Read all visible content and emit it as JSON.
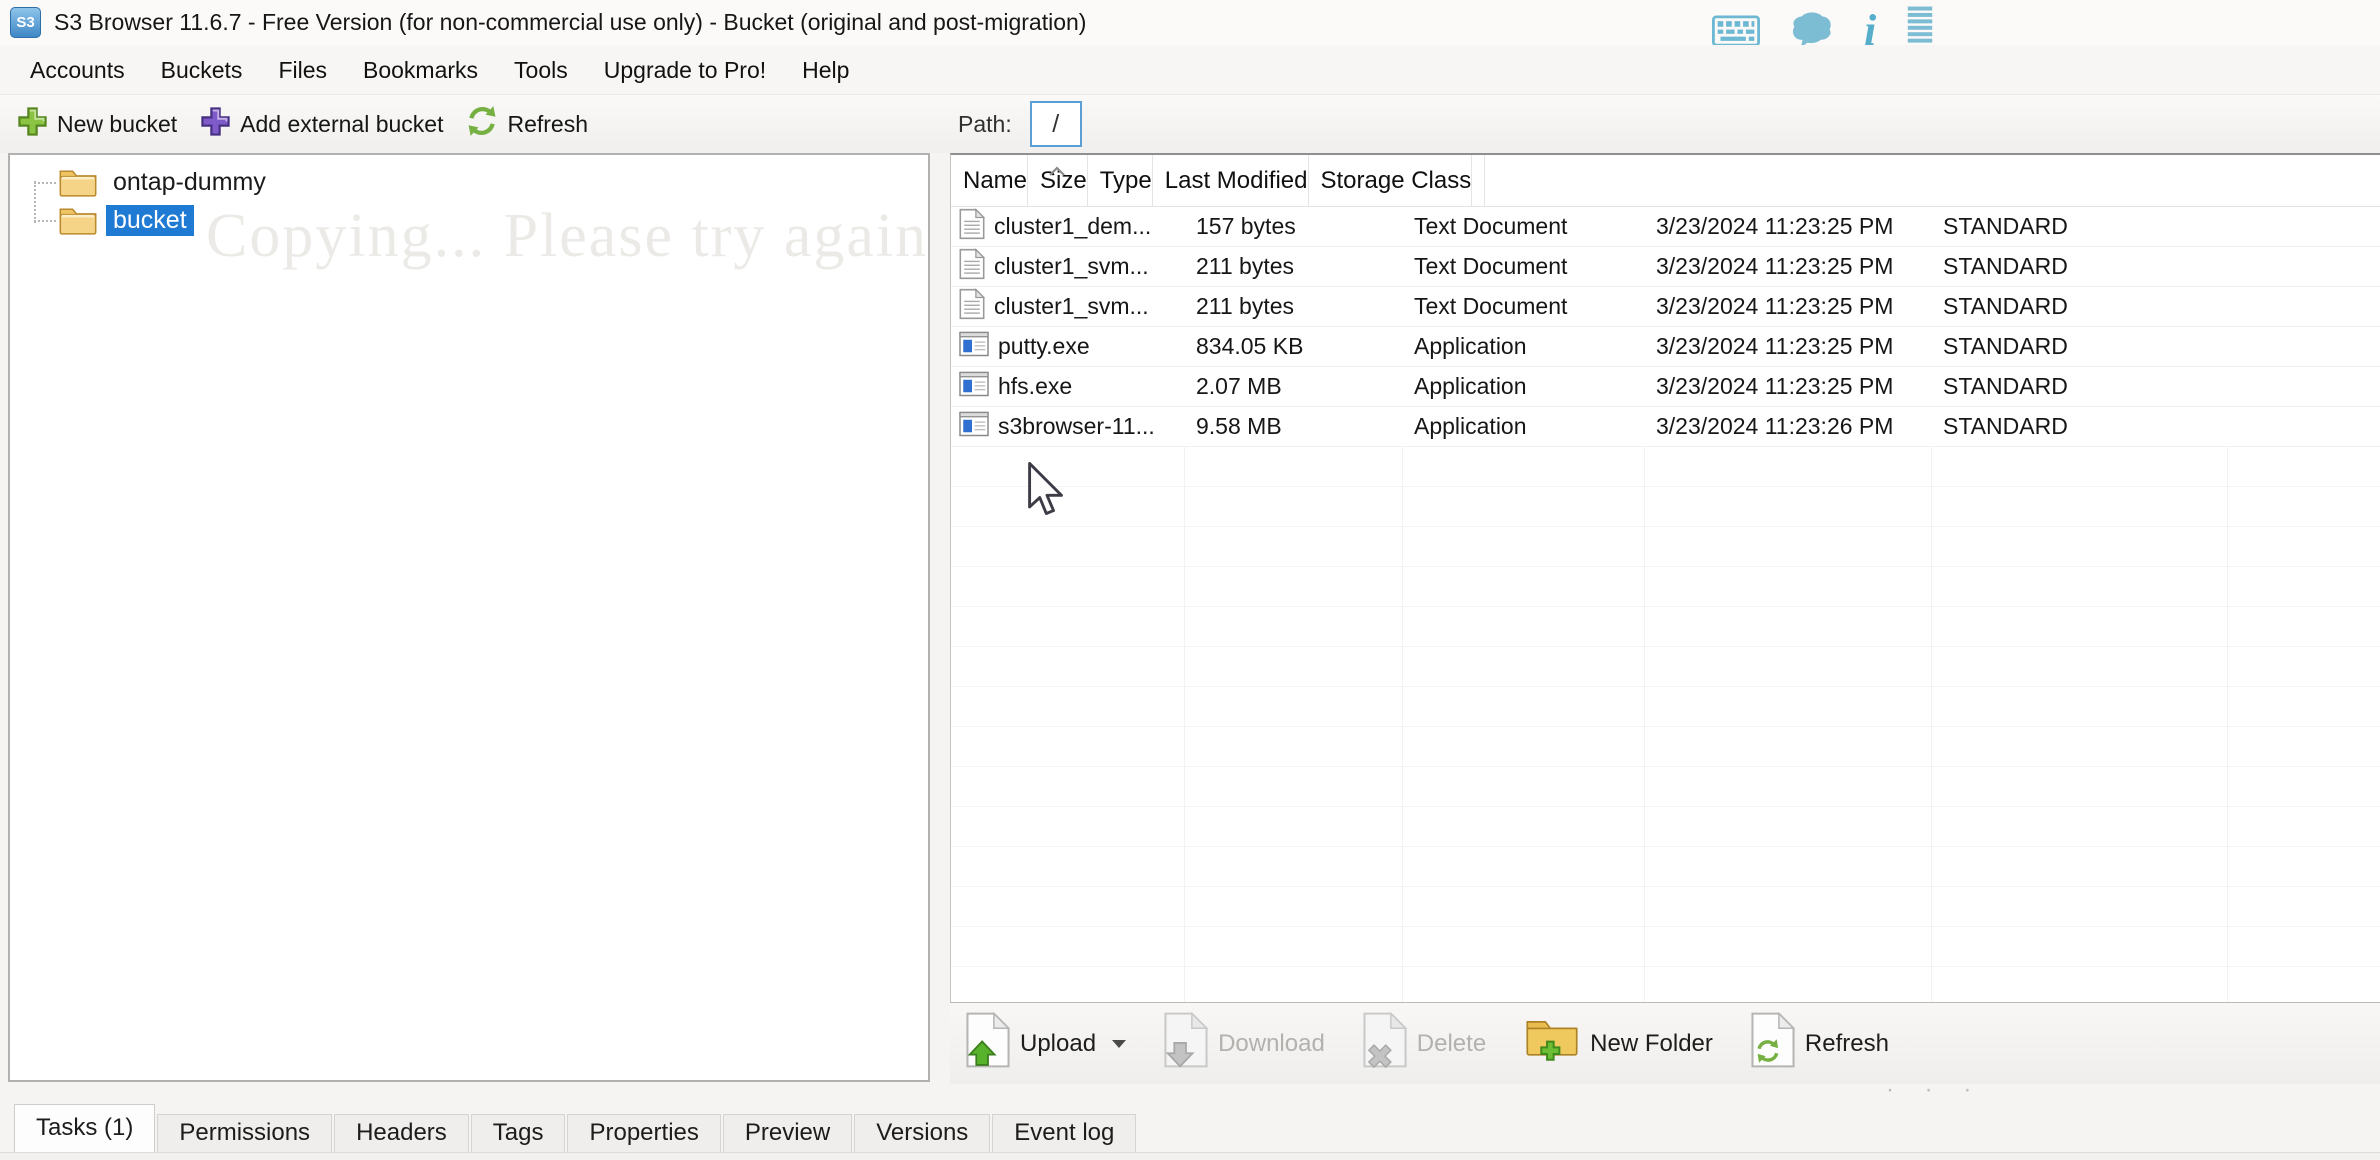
{
  "window": {
    "title": "S3 Browser 11.6.7 - Free Version (for non-commercial use only) - Bucket (original and post-migration)",
    "app_icon_text": "S3"
  },
  "titlebar_icons": [
    "keyboard-icon",
    "chat-bubble-icon",
    "info-icon",
    "list-stripes-icon"
  ],
  "menu": {
    "items": [
      {
        "label": "Accounts"
      },
      {
        "label": "Buckets"
      },
      {
        "label": "Files"
      },
      {
        "label": "Bookmarks"
      },
      {
        "label": "Tools"
      },
      {
        "label": "Upgrade to Pro!"
      },
      {
        "label": "Help"
      }
    ]
  },
  "bucket_toolbar": {
    "new_bucket": "New bucket",
    "add_external_bucket": "Add external bucket",
    "refresh": "Refresh"
  },
  "path_bar": {
    "label": "Path:",
    "value": "/"
  },
  "tree": {
    "items": [
      {
        "label": "ontap-dummy",
        "selected": false
      },
      {
        "label": "bucket",
        "selected": true
      }
    ],
    "overlay_text": "Copying... Please try again",
    "overlay_dots": "· · ·"
  },
  "file_list": {
    "columns": [
      {
        "label": "Name"
      },
      {
        "label": "Size",
        "sort": "asc"
      },
      {
        "label": "Type"
      },
      {
        "label": "Last Modified"
      },
      {
        "label": "Storage Class"
      },
      {
        "label": ""
      }
    ],
    "rows": [
      {
        "name": "cluster1_dem...",
        "size": "157 bytes",
        "type": "Text Document",
        "modified": "3/23/2024 11:23:25 PM",
        "storage_class": "STANDARD",
        "icon": "text-document"
      },
      {
        "name": "cluster1_svm...",
        "size": "211 bytes",
        "type": "Text Document",
        "modified": "3/23/2024 11:23:25 PM",
        "storage_class": "STANDARD",
        "icon": "text-document"
      },
      {
        "name": "cluster1_svm...",
        "size": "211 bytes",
        "type": "Text Document",
        "modified": "3/23/2024 11:23:25 PM",
        "storage_class": "STANDARD",
        "icon": "text-document"
      },
      {
        "name": "putty.exe",
        "size": "834.05 KB",
        "type": "Application",
        "modified": "3/23/2024 11:23:25 PM",
        "storage_class": "STANDARD",
        "icon": "application"
      },
      {
        "name": "hfs.exe",
        "size": "2.07 MB",
        "type": "Application",
        "modified": "3/23/2024 11:23:25 PM",
        "storage_class": "STANDARD",
        "icon": "application"
      },
      {
        "name": "s3browser-11...",
        "size": "9.58 MB",
        "type": "Application",
        "modified": "3/23/2024 11:23:26 PM",
        "storage_class": "STANDARD",
        "icon": "application"
      }
    ]
  },
  "actions": {
    "upload": {
      "label": "Upload",
      "enabled": true,
      "has_dropdown": true
    },
    "download": {
      "label": "Download",
      "enabled": false
    },
    "delete": {
      "label": "Delete",
      "enabled": false
    },
    "new_folder": {
      "label": "New Folder",
      "enabled": true
    },
    "refresh": {
      "label": "Refresh",
      "enabled": true
    }
  },
  "tabs": {
    "items": [
      {
        "label": "Tasks (1)",
        "active": true
      },
      {
        "label": "Permissions",
        "active": false
      },
      {
        "label": "Headers",
        "active": false
      },
      {
        "label": "Tags",
        "active": false
      },
      {
        "label": "Properties",
        "active": false
      },
      {
        "label": "Preview",
        "active": false
      },
      {
        "label": "Versions",
        "active": false
      },
      {
        "label": "Event log",
        "active": false
      }
    ]
  },
  "colors": {
    "selection_blue": "#1f7ad4",
    "titlebar_icon_teal": "#6db8d2",
    "plus_green": "#8bc442",
    "plus_purple": "#7e5bc8",
    "refresh_green": "#76b043",
    "folder_yellow": "#f5d488",
    "app_icon_blue": "#2e6fd0"
  }
}
